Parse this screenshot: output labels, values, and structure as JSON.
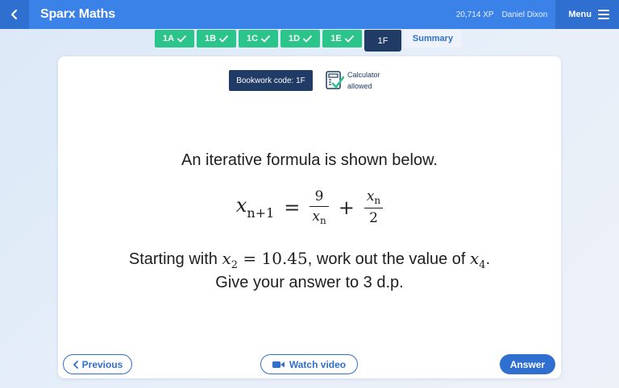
{
  "header": {
    "app_title": "Sparx Maths",
    "xp": "20,714 XP",
    "user_name": "Daniel Dixon",
    "menu_label": "Menu",
    "accent_color": "#3b82e8",
    "dark_color": "#1f3b66"
  },
  "tabs": [
    {
      "label": "1A",
      "completed": true,
      "icon": "check-icon"
    },
    {
      "label": "1B",
      "completed": true,
      "icon": "check-icon"
    },
    {
      "label": "1C",
      "completed": true,
      "icon": "check-icon"
    },
    {
      "label": "1D",
      "completed": true,
      "icon": "check-icon"
    },
    {
      "label": "1E",
      "completed": true,
      "icon": "check-icon"
    },
    {
      "label": "1F",
      "completed": false,
      "active": true
    },
    {
      "label": "Summary"
    }
  ],
  "question": {
    "bookwork_code": "Bookwork code: 1F",
    "calculator_line1": "Calculator",
    "calculator_line2": "allowed",
    "line1": "An iterative formula is shown below.",
    "formula": {
      "lhs_var": "x",
      "lhs_sub": "n+1",
      "equals": "=",
      "frac1_num": "9",
      "frac1_den_var": "x",
      "frac1_den_sub": "n",
      "plus": "+",
      "frac2_num_var": "x",
      "frac2_num_sub": "n",
      "frac2_den": "2"
    },
    "line2_prefix": "Starting with ",
    "line2_var": "x",
    "line2_var_sub": "2",
    "line2_eq": " = 10.45",
    "line2_mid": ", work out the value of ",
    "line2_target_var": "x",
    "line2_target_sub": "4",
    "line2_suffix": ".",
    "line3": "Give your answer to 3 d.p."
  },
  "buttons": {
    "previous": "Previous",
    "watch_video": "Watch video",
    "answer": "Answer"
  }
}
